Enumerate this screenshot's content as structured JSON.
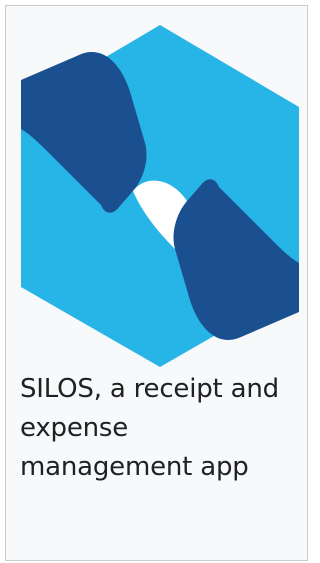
{
  "logo": {
    "icon": "silos-s-logo-icon",
    "colors": {
      "light": "#27b4e6",
      "dark": "#1a4f90"
    }
  },
  "caption": {
    "text": "SILOS, a receipt and expense management app"
  }
}
